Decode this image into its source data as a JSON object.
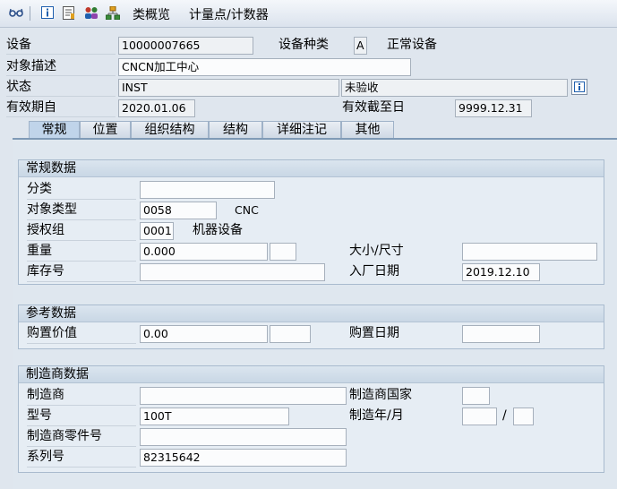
{
  "toolbar": {
    "icons": [
      "glasses-icon",
      "info-icon",
      "document-icon",
      "users-icon",
      "hierarchy-icon"
    ],
    "class_overview": "类概览",
    "measuring_points": "计量点/计数器"
  },
  "header": {
    "equipment_label": "设备",
    "equipment_value": "10000007665",
    "category_label": "设备种类",
    "category_value": "A",
    "category_text": "正常设备",
    "description_label": "对象描述",
    "description_value": "CNCN加工中心",
    "status_label": "状态",
    "status_value": "INST",
    "user_status_value": "未验收",
    "valid_from_label": "有效期自",
    "valid_from_value": "2020.01.06",
    "valid_to_label": "有效截至日",
    "valid_to_value": "9999.12.31"
  },
  "tabs": [
    {
      "label": "常规",
      "active": true
    },
    {
      "label": "位置",
      "active": false
    },
    {
      "label": "组织结构",
      "active": false
    },
    {
      "label": "结构",
      "active": false
    },
    {
      "label": "详细注记",
      "active": false
    },
    {
      "label": "其他",
      "active": false
    }
  ],
  "general": {
    "title": "常规数据",
    "class_label": "分类",
    "class_value": "",
    "object_type_label": "对象类型",
    "object_type_value": "0058",
    "object_type_text": "CNC",
    "auth_group_label": "授权组",
    "auth_group_value": "0001",
    "auth_group_text": "机器设备",
    "weight_label": "重量",
    "weight_value": "0.000",
    "weight_unit": "",
    "size_label": "大小/尺寸",
    "size_value": "",
    "inventory_label": "库存号",
    "inventory_value": "",
    "startup_label": "入厂日期",
    "startup_value": "2019.12.10"
  },
  "reference": {
    "title": "参考数据",
    "acq_value_label": "购置价值",
    "acq_value_value": "0.00",
    "acq_value_currency": "",
    "acq_date_label": "购置日期",
    "acq_date_value": ""
  },
  "manufacturer": {
    "title": "制造商数据",
    "manufacturer_label": "制造商",
    "manufacturer_value": "",
    "country_label": "制造商国家",
    "country_value": "",
    "model_label": "型号",
    "model_value": "100T",
    "year_month_label": "制造年/月",
    "year_value": "",
    "separator": "/",
    "month_value": "",
    "part_no_label": "制造商零件号",
    "part_no_value": "",
    "serial_label": "系列号",
    "serial_value": "82315642"
  },
  "colors": {
    "background": "#dfe6ee",
    "tab_active": "#c0d4ea",
    "group_title": "#c9d7e5",
    "info_blue": "#1f5fae"
  }
}
